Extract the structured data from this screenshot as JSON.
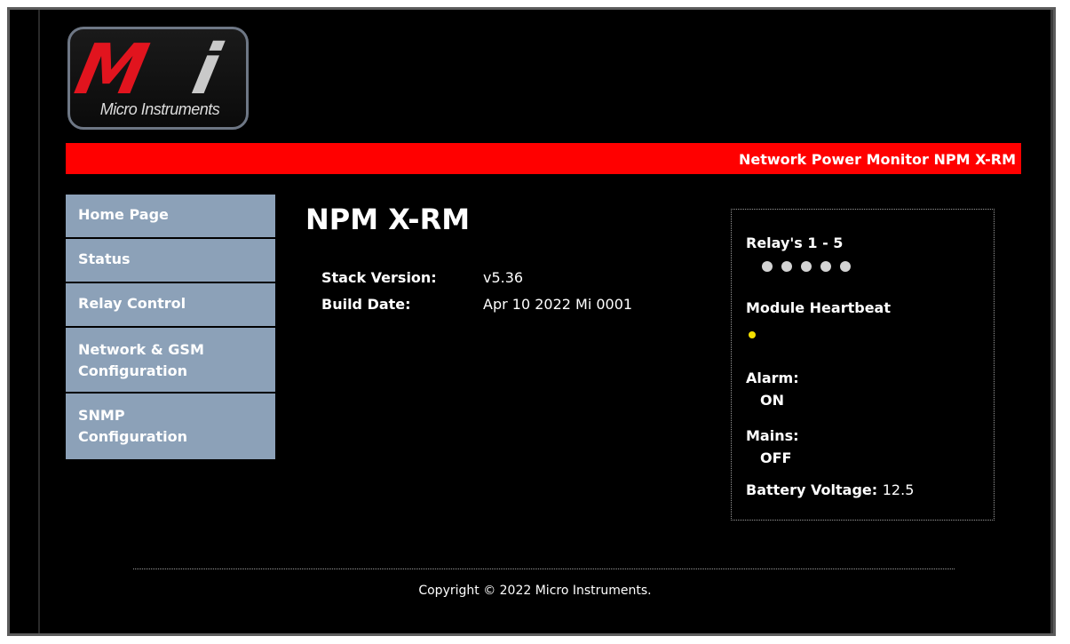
{
  "brand": {
    "logo_text": "Micro Instruments",
    "logo_letters": "Mi"
  },
  "header": {
    "banner_title": "Network Power Monitor NPM X-RM"
  },
  "nav": {
    "items": [
      {
        "label": "Home Page"
      },
      {
        "label": "Status"
      },
      {
        "label": "Relay Control"
      },
      {
        "label_line1": "Network & GSM",
        "label_line2": "Configuration"
      },
      {
        "label_line1": "SNMP",
        "label_line2": "Configuration"
      }
    ]
  },
  "main": {
    "title": "NPM X-RM",
    "stack_version_label": "Stack Version:",
    "stack_version_value": "v5.36",
    "build_date_label": "Build Date:",
    "build_date_value": "Apr 10 2022 Mi 0001"
  },
  "status": {
    "relays_label": "Relay's 1 - 5",
    "relay_count": 5,
    "relay_dot_color": "#d3d3d3",
    "heartbeat_label": "Module Heartbeat",
    "heartbeat_color": "#f5e000",
    "alarm_label": "Alarm:",
    "alarm_value": "ON",
    "mains_label": "Mains:",
    "mains_value": "OFF",
    "battery_label": "Battery Voltage:",
    "battery_value": "12.5"
  },
  "footer": {
    "copyright": "Copyright © 2022 Micro Instruments."
  },
  "colors": {
    "background": "#000000",
    "banner": "#ff0000",
    "nav": "#8ca1b8",
    "logo_red": "#e1141e"
  }
}
